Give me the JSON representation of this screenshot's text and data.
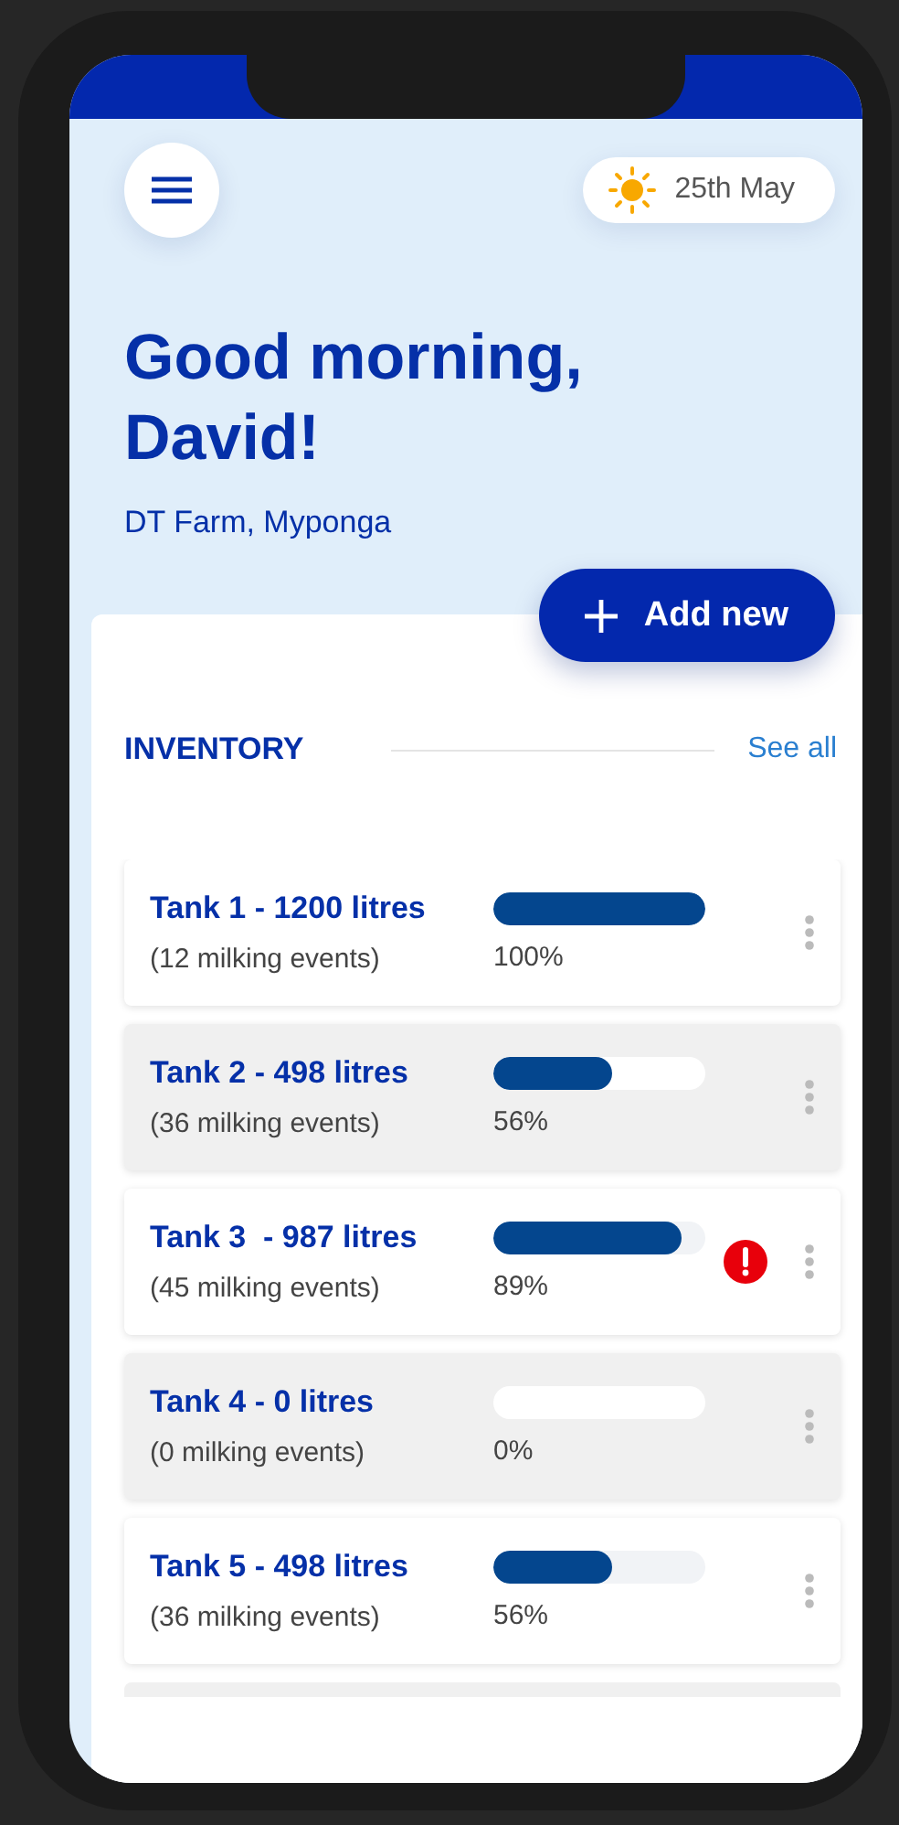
{
  "header": {
    "date": "25th May",
    "greeting": "Good morning, David!",
    "farm": "DT Farm, Myponga"
  },
  "add_button": {
    "label": "Add new"
  },
  "inventory": {
    "title": "INVENTORY",
    "see_all": "See all",
    "tanks": [
      {
        "name": "Tank 1 - 1200 litres",
        "events": "(12 milking events)",
        "level": 1.0,
        "reading": "100%",
        "alert": false
      },
      {
        "name": "Tank 2 - 498 litres",
        "events": "(36 milking events)",
        "level": 0.56,
        "reading": "56%",
        "alert": false
      },
      {
        "name": "Tank 3  - 987 litres",
        "events": "(45 milking events)",
        "level": 0.89,
        "reading": "89%",
        "alert": true
      },
      {
        "name": "Tank 4 - 0 litres",
        "events": "(0 milking events)",
        "reading": "0%",
        "alert": false
      },
      {
        "name": "Tank 5 - 498 litres",
        "events": "(36 milking events)",
        "level": 0.56,
        "reading": "56%",
        "alert": false
      }
    ]
  }
}
